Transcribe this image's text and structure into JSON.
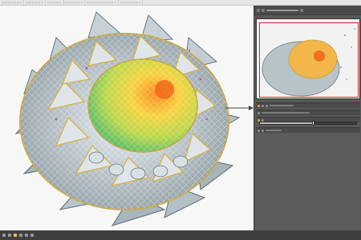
{
  "tabs": [
    {
      "label": "▢ ▢ ▢ ▢ ▢ ▢"
    },
    {
      "label": "▢ ▢ ▢ ▢ ▢"
    },
    {
      "label": "▢ ▢ ▢ ▢"
    },
    {
      "label": "▢ ▢ ▢ ▢ ▢"
    },
    {
      "label": "▢ ▢ ▢ ▢ ▢ ▢ ▢ ▢ ▢"
    },
    {
      "label": "▢ ▢ ▢ ▢ ▢ ▢"
    }
  ],
  "panel": {
    "navigator_label": "",
    "slider_level": 0.55
  },
  "colors": {
    "panel_bg": "#585858",
    "accent": "#e0a23b",
    "frame": "#dd2222",
    "canvas_bg": "#f7f7f7"
  },
  "statusbar": {
    "icons": [
      "grid-icon",
      "layers-icon",
      "star-icon",
      "brush-icon",
      "zoom-icon",
      "hand-icon"
    ]
  }
}
